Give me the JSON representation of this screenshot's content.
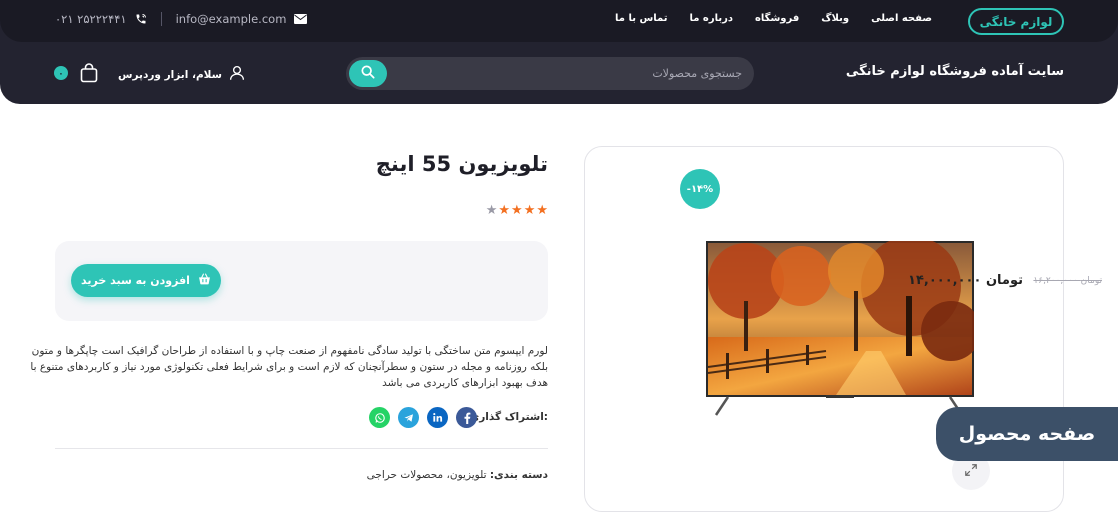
{
  "header": {
    "logo": "لوازم خانگی",
    "nav": [
      "صفحه اصلی",
      "وبلاگ",
      "فروشگاه",
      "درباره ما",
      "تماس با ما"
    ],
    "email": "info@example.com",
    "phone": "۰۲۱ ۲۵۲۲۲۴۴۱",
    "site_title": "سایت آماده فروشگاه لوازم خانگی",
    "search_placeholder": "جستجوی محصولات",
    "user_greeting": "سلام، ابزار وردپرس",
    "cart_count": "۰"
  },
  "product": {
    "title": "تلویزیون 55 اینچ",
    "rating": 4,
    "rating_max": 5,
    "discount_badge": "-۱۴%",
    "old_price": "۱۶,۲۰۰,۰۰۰ تومان",
    "new_price": "۱۴,۰۰۰,۰۰۰ تومان",
    "add_to_cart": "افزودن به سبد خرید",
    "description": "لورم ایپسوم متن ساختگی با تولید سادگی نامفهوم از صنعت چاپ و با استفاده از طراحان گرافیک است چاپگرها و متون بلکه روزنامه و مجله در ستون و سطرآنچنان که لازم است و برای شرایط فعلی تکنولوژی مورد نیاز و کاربردهای متنوع با هدف بهبود ابزارهای کاربردی می باشد",
    "share_label": "اشتراک گذاری:",
    "category_label": "دسته بندی:",
    "categories": "تلویزیون، محصولات حراجی"
  },
  "page_tag": "صفحه محصول",
  "colors": {
    "accent": "#2ec4b6",
    "header_bg": "#232330",
    "star": "#f37021",
    "tag_bg": "#3c5068"
  }
}
